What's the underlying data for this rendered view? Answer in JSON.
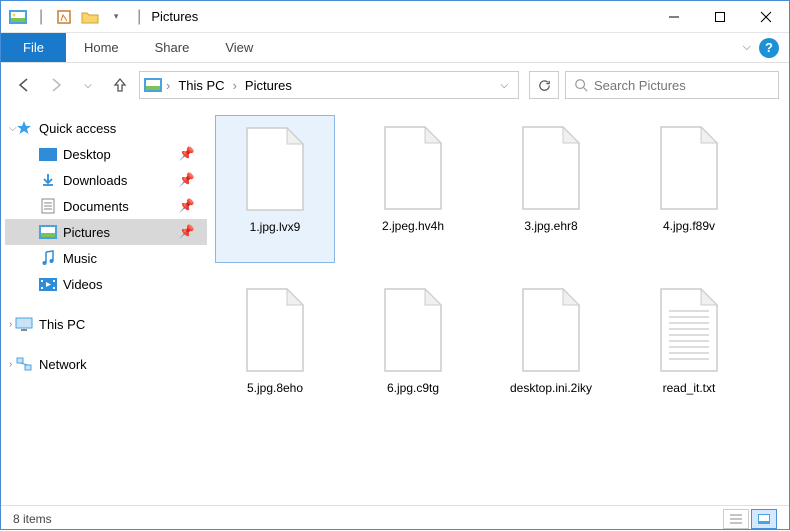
{
  "title": "Pictures",
  "ribbon": {
    "file": "File",
    "tabs": [
      "Home",
      "Share",
      "View"
    ]
  },
  "breadcrumb": {
    "parts": [
      "This PC",
      "Pictures"
    ]
  },
  "search": {
    "placeholder": "Search Pictures"
  },
  "sidebar": {
    "quick_access": "Quick access",
    "items": [
      {
        "label": "Desktop",
        "pinned": true
      },
      {
        "label": "Downloads",
        "pinned": true
      },
      {
        "label": "Documents",
        "pinned": true
      },
      {
        "label": "Pictures",
        "pinned": true,
        "selected": true
      },
      {
        "label": "Music",
        "pinned": false
      },
      {
        "label": "Videos",
        "pinned": false
      }
    ],
    "this_pc": "This PC",
    "network": "Network"
  },
  "files": [
    {
      "name": "1.jpg.lvx9",
      "type": "blank",
      "selected": true
    },
    {
      "name": "2.jpeg.hv4h",
      "type": "blank"
    },
    {
      "name": "3.jpg.ehr8",
      "type": "blank"
    },
    {
      "name": "4.jpg.f89v",
      "type": "blank"
    },
    {
      "name": "5.jpg.8eho",
      "type": "blank"
    },
    {
      "name": "6.jpg.c9tg",
      "type": "blank"
    },
    {
      "name": "desktop.ini.2iky",
      "type": "blank"
    },
    {
      "name": "read_it.txt",
      "type": "txt"
    }
  ],
  "status": {
    "text": "8 items"
  }
}
